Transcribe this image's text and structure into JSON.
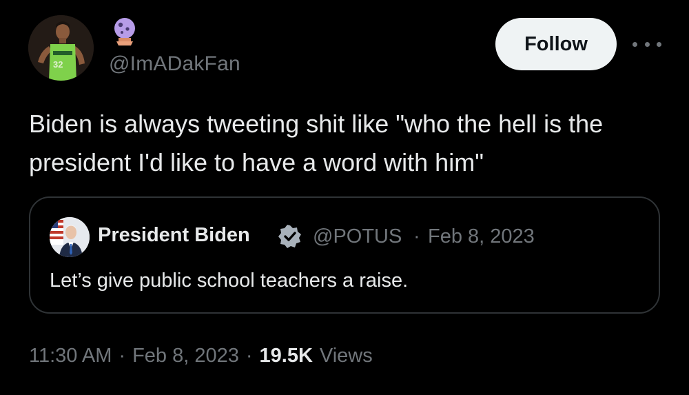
{
  "author": {
    "handle": "@ImADakFan",
    "emoji_badge": "crystal-ball-icon"
  },
  "follow_label": "Follow",
  "tweet_text": "Biden is always tweeting shit like \"who the hell is the\npresident I'd like to have a word with him\"",
  "quoted": {
    "name": "President Biden",
    "handle": "@POTUS",
    "separator": "·",
    "date": "Feb 8, 2023",
    "text": "Let’s give public school teachers a raise.",
    "verified_color": "#a8b1ba"
  },
  "meta": {
    "time": "11:30 AM",
    "dot1": "·",
    "date": "Feb 8, 2023",
    "dot2": "·",
    "views_count": "19.5K",
    "views_label": "Views"
  },
  "colors": {
    "background": "#000000",
    "text_primary": "#e7e9ea",
    "text_secondary": "#71767b",
    "follow_bg": "#eff3f4",
    "border": "#2f3336"
  }
}
